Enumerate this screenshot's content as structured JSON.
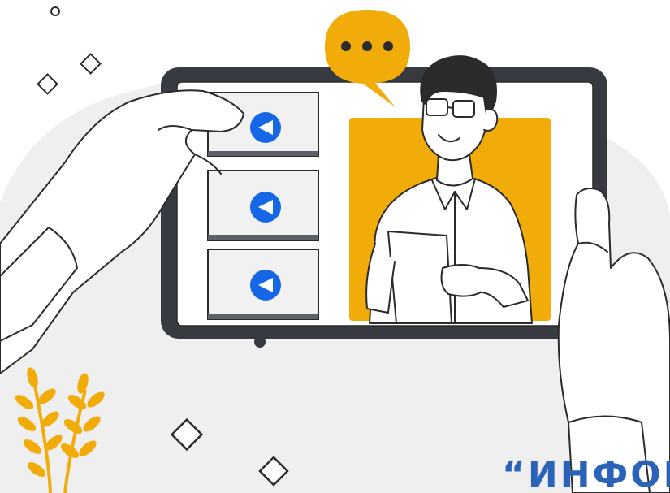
{
  "caption_text": "“ИНФОР",
  "colors": {
    "background_blob": "#efefef",
    "tablet_frame": "#373b41",
    "accent_yellow": "#f2ac0a",
    "play_button_blue": "#1667e6",
    "caption_blue": "#2a63b8",
    "outline": "#2b2b2b"
  },
  "icons": [
    "speech-bubble-icon",
    "play-icon",
    "play-icon",
    "play-icon",
    "wheat-icon",
    "diamond-icon",
    "circle-icon"
  ]
}
